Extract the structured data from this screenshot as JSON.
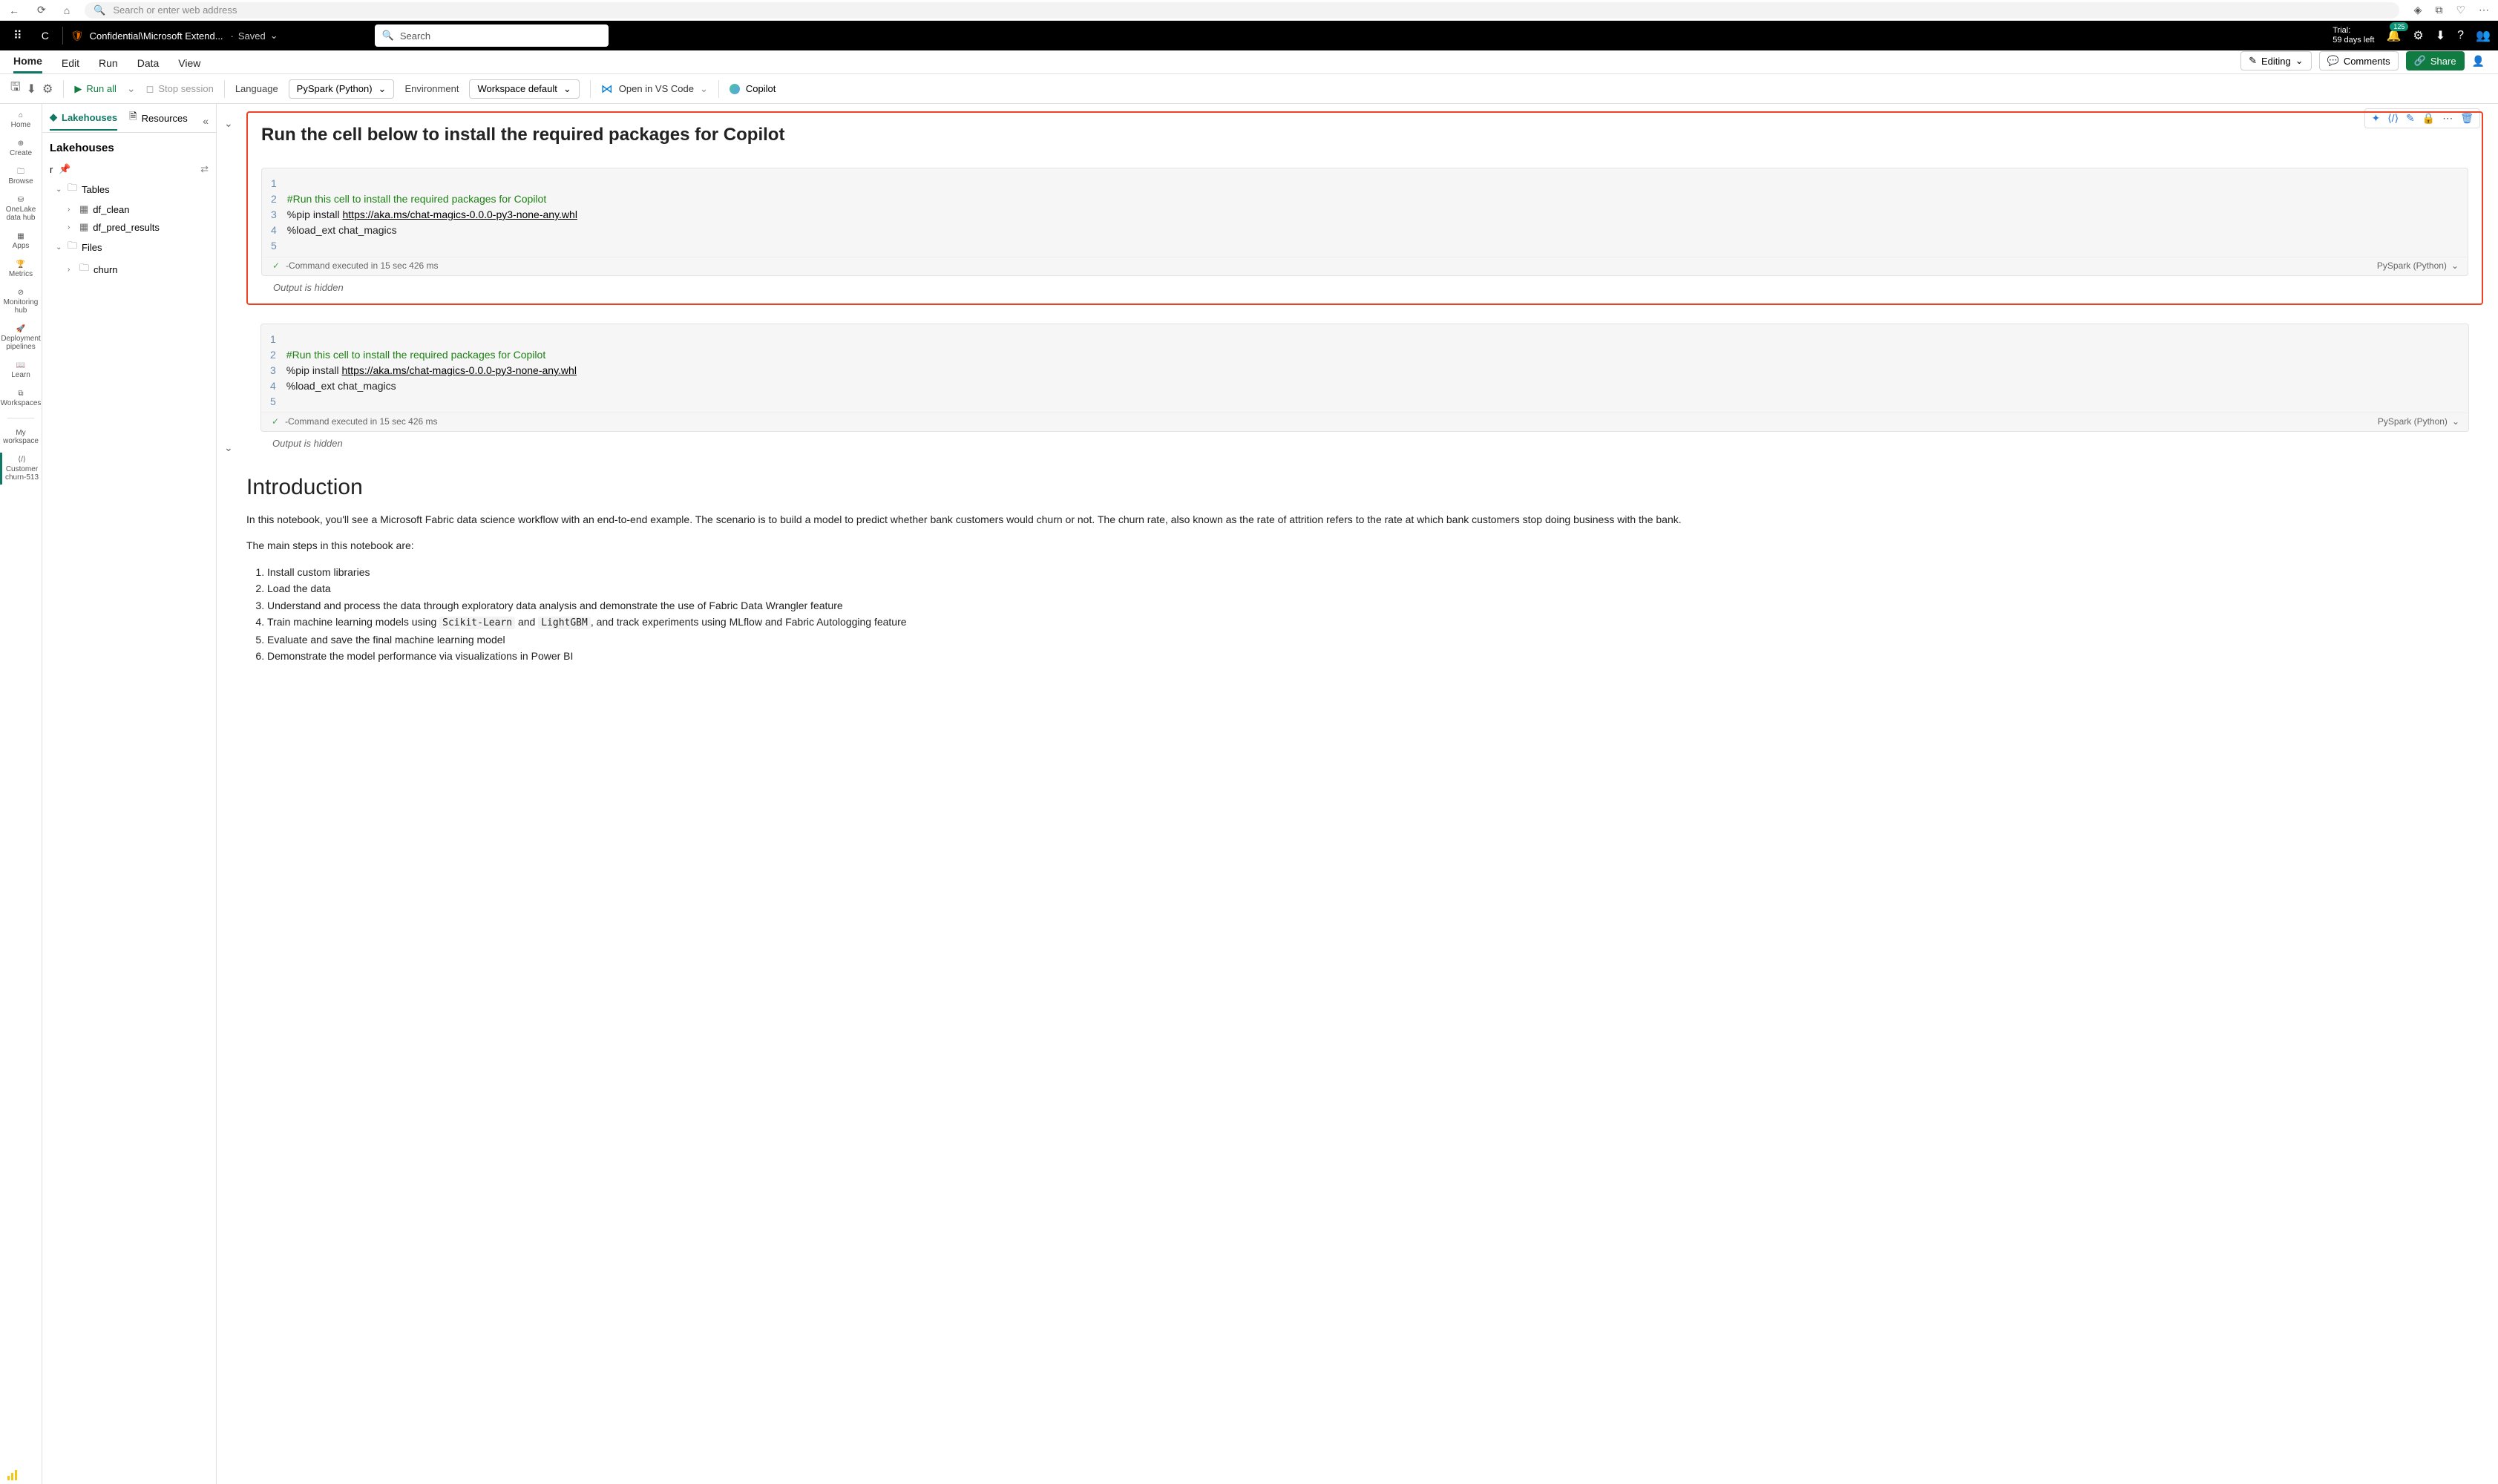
{
  "browser": {
    "placeholder": "Search or enter web address"
  },
  "appbar": {
    "letter": "C",
    "breadcrumb": "Confidential\\Microsoft Extend...",
    "saved": "Saved",
    "search_placeholder": "Search",
    "trial_l1": "Trial:",
    "trial_l2": "59 days left",
    "badge": "125"
  },
  "ribbon": {
    "tabs": [
      "Home",
      "Edit",
      "Run",
      "Data",
      "View"
    ],
    "editing": "Editing",
    "comments": "Comments",
    "share": "Share"
  },
  "toolbar": {
    "run_all": "Run all",
    "stop": "Stop session",
    "language_label": "Language",
    "language_value": "PySpark (Python)",
    "env_label": "Environment",
    "env_value": "Workspace default",
    "vscode": "Open in VS Code",
    "copilot": "Copilot"
  },
  "leftrail": {
    "home": "Home",
    "create": "Create",
    "browse": "Browse",
    "onelake": "OneLake data hub",
    "apps": "Apps",
    "metrics": "Metrics",
    "monitoring": "Monitoring hub",
    "pipelines": "Deployment pipelines",
    "learn": "Learn",
    "workspaces": "Workspaces",
    "myws": "My workspace",
    "customer": "Customer churn-513"
  },
  "explorer": {
    "tab1": "Lakehouses",
    "tab2": "Resources",
    "heading": "Lakehouses",
    "item_r": "r",
    "tables": "Tables",
    "df_clean": "df_clean",
    "df_pred": "df_pred_results",
    "files": "Files",
    "churn": "churn"
  },
  "cell1": {
    "heading": "Run the cell below to install the required packages for Copilot",
    "line2": "#Run this cell to install the required packages for Copilot",
    "line3a": "%pip install ",
    "line3b": "https://aka.ms/chat-magics-0.0.0-py3-none-any.whl",
    "line4": "%load_ext chat_magics",
    "status": "-Command executed in 15 sec 426 ms",
    "lang": "PySpark (Python)",
    "output": "Output is hidden"
  },
  "cell2": {
    "line2": "#Run this cell to install the required packages for Copilot",
    "line3a": "%pip install ",
    "line3b": "https://aka.ms/chat-magics-0.0.0-py3-none-any.whl",
    "line4": "%load_ext chat_magics",
    "status": "-Command executed in 15 sec 426 ms",
    "lang": "PySpark (Python)",
    "output": "Output is hidden"
  },
  "intro": {
    "title": "Introduction",
    "p1": "In this notebook, you'll see a Microsoft Fabric data science workflow with an end-to-end example. The scenario is to build a model to predict whether bank customers would churn or not. The churn rate, also known as the rate of attrition refers to the rate at which bank customers stop doing business with the bank.",
    "p2": "The main steps in this notebook are:",
    "li1": "Install custom libraries",
    "li2": "Load the data",
    "li3": "Understand and process the data through exploratory data analysis and demonstrate the use of Fabric Data Wrangler feature",
    "li4a": "Train machine learning models using ",
    "li4b": "Scikit-Learn",
    "li4c": " and ",
    "li4d": "LightGBM",
    "li4e": ", and track experiments using MLflow and Fabric Autologging feature",
    "li5": "Evaluate and save the final machine learning model",
    "li6": "Demonstrate the model performance via visualizations in Power BI"
  }
}
